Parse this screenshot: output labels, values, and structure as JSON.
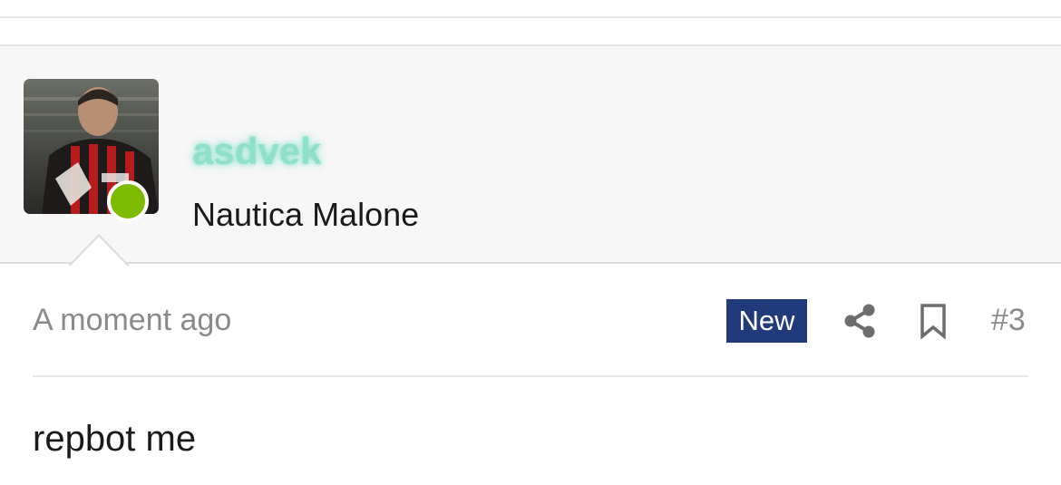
{
  "post": {
    "author": {
      "username": "asdvek",
      "user_title": "Nautica Malone",
      "online": true,
      "username_color": "#8fe0c8",
      "online_color": "#7cbb00"
    },
    "timestamp": "A moment ago",
    "badge": "New",
    "badge_color": "#213a7a",
    "post_number": "#3",
    "body": "repbot me",
    "icons": {
      "share": "share-icon",
      "bookmark": "bookmark-icon"
    }
  }
}
